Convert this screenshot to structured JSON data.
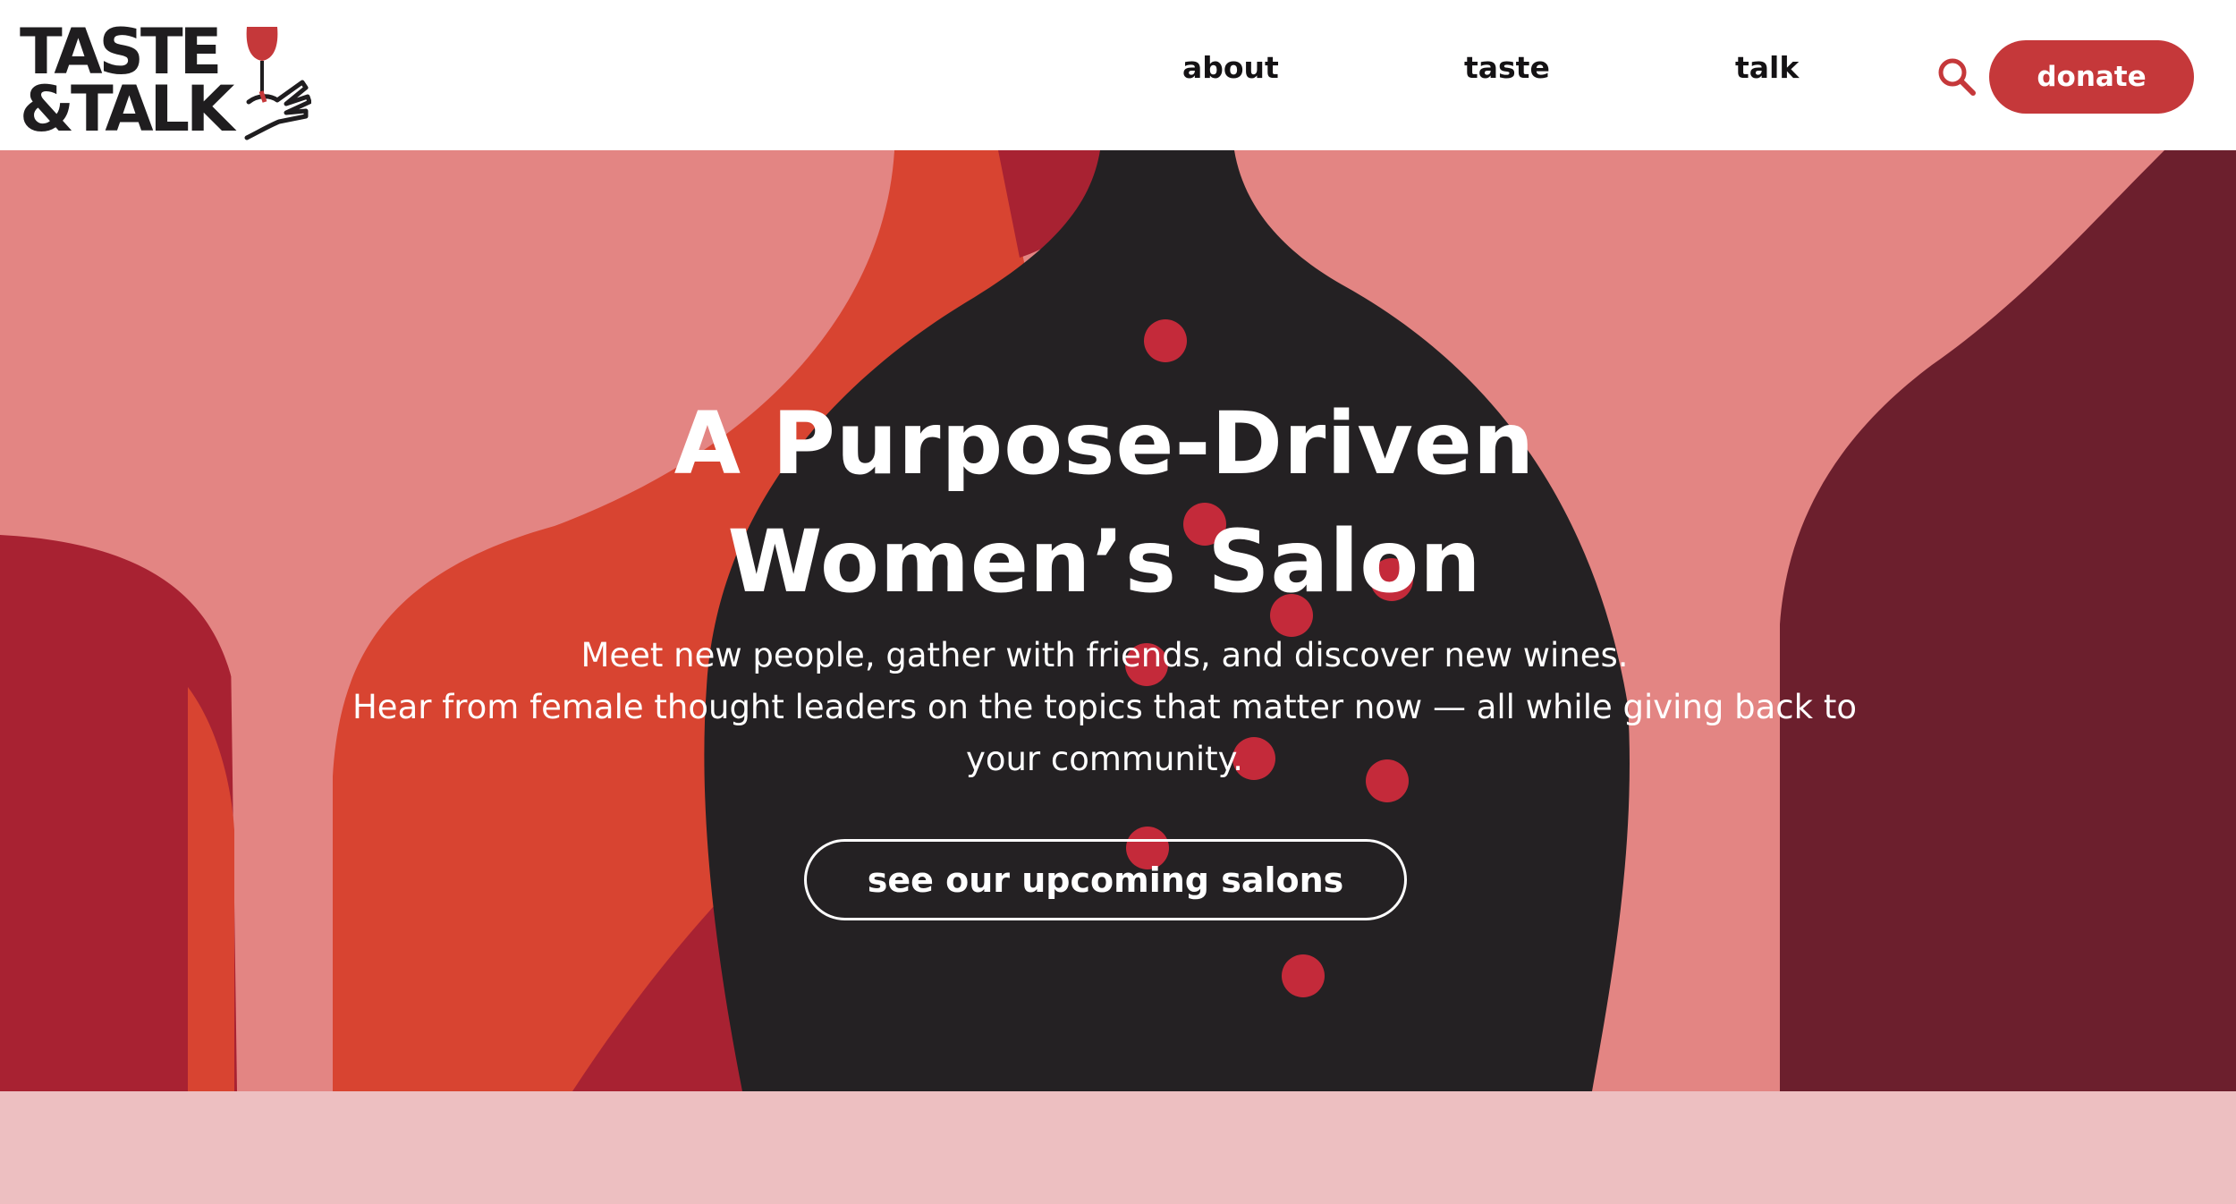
{
  "brand": {
    "logo_line1": "TASTE",
    "logo_line2": "&TALK"
  },
  "nav": {
    "items": [
      {
        "label": "about"
      },
      {
        "label": "taste"
      },
      {
        "label": "talk"
      }
    ],
    "search_icon": "search-icon",
    "donate_label": "donate"
  },
  "hero": {
    "title_line1": "A Purpose-Driven",
    "title_line2": "Women’s Salon",
    "subtitle_line1": "Meet new people, gather with friends, and discover new wines.",
    "subtitle_line2": "Hear from female thought leaders on the topics that matter now — all while giving back to",
    "subtitle_line3": "your community.",
    "cta_label": "see our upcoming salons"
  },
  "colors": {
    "accent": "#c5383a",
    "hero_pink": "#e38583",
    "hero_red": "#a82232",
    "hero_orange": "#d84431",
    "hero_dark": "#242123",
    "hero_burgundy": "#6c1f2d",
    "section_pink": "#edbfc1",
    "text_dark": "#141214"
  }
}
